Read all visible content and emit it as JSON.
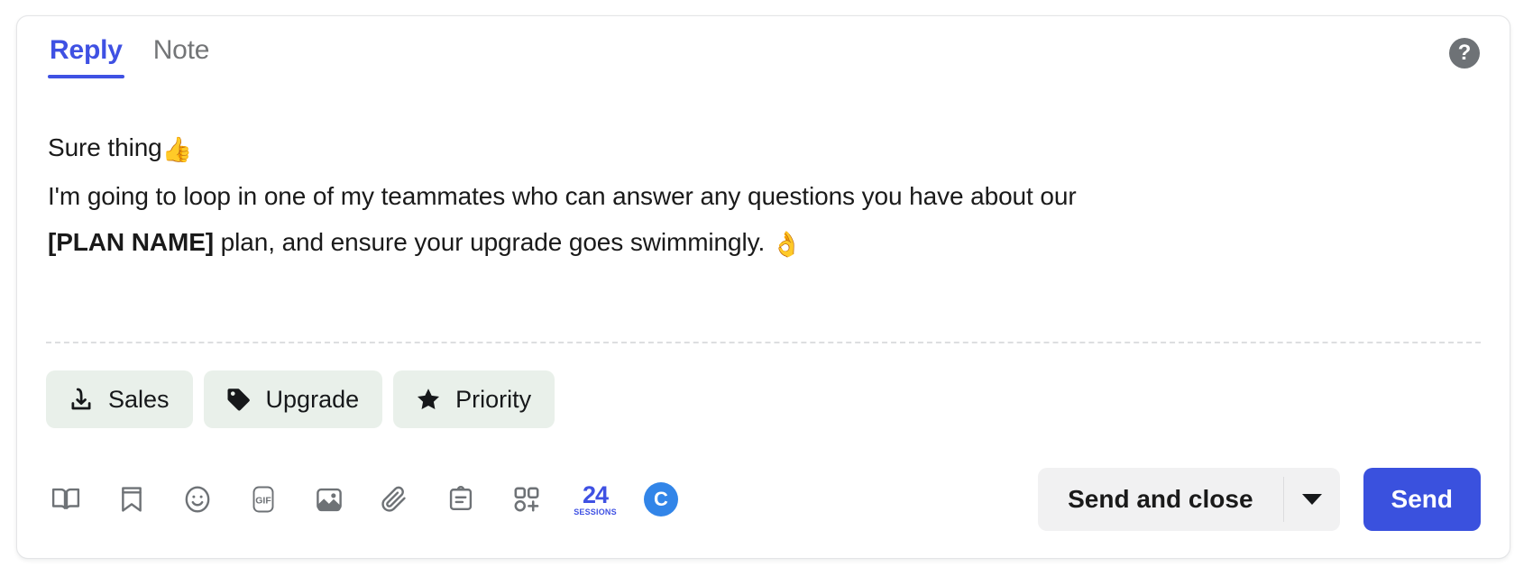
{
  "card": {
    "tabs": [
      {
        "label": "Reply",
        "active": true
      },
      {
        "label": "Note",
        "active": false
      }
    ],
    "help_icon_glyph": "?",
    "help_icon_name": "help-question-icon"
  },
  "message": {
    "line1_text": "Sure thing",
    "line1_emoji": "👍",
    "line2": "I'm going to loop in one of my teammates who can answer any questions you have about our",
    "line3_token": "[PLAN NAME]",
    "line3_rest": " plan, and ensure your upgrade goes swimmingly. ",
    "line3_emoji": "👌"
  },
  "tags": [
    {
      "label": "Sales",
      "icon": "save-download-icon"
    },
    {
      "label": "Upgrade",
      "icon": "tag-icon"
    },
    {
      "label": "Priority",
      "icon": "star-icon"
    }
  ],
  "toolbar": {
    "icons": [
      {
        "name": "book-icon",
        "title": "Articles"
      },
      {
        "name": "bookmark-icon",
        "title": "Saved replies"
      },
      {
        "name": "emoji-icon",
        "title": "Emoji"
      },
      {
        "name": "gif-icon",
        "title": "GIF",
        "text": "GIF"
      },
      {
        "name": "image-icon",
        "title": "Image"
      },
      {
        "name": "paperclip-icon",
        "title": "Attachment"
      },
      {
        "name": "article-icon",
        "title": "Conversation notes"
      },
      {
        "name": "apps-grid-plus-icon",
        "title": "Apps"
      }
    ],
    "app_24sessions": {
      "big": "24",
      "small": "SESSIONS"
    },
    "app_circle_c": {
      "letter": "C"
    }
  },
  "actions": {
    "send_and_close_label": "Send and close",
    "dropdown_icon": "chevron-down-icon",
    "send_label": "Send"
  },
  "colors": {
    "accent_blue": "#3f51e3",
    "send_blue": "#3a51de",
    "chip_green": "#e9f0ea",
    "app_blue": "#3285e8",
    "text_dark": "#1a1a1a",
    "text_muted": "#737577"
  }
}
